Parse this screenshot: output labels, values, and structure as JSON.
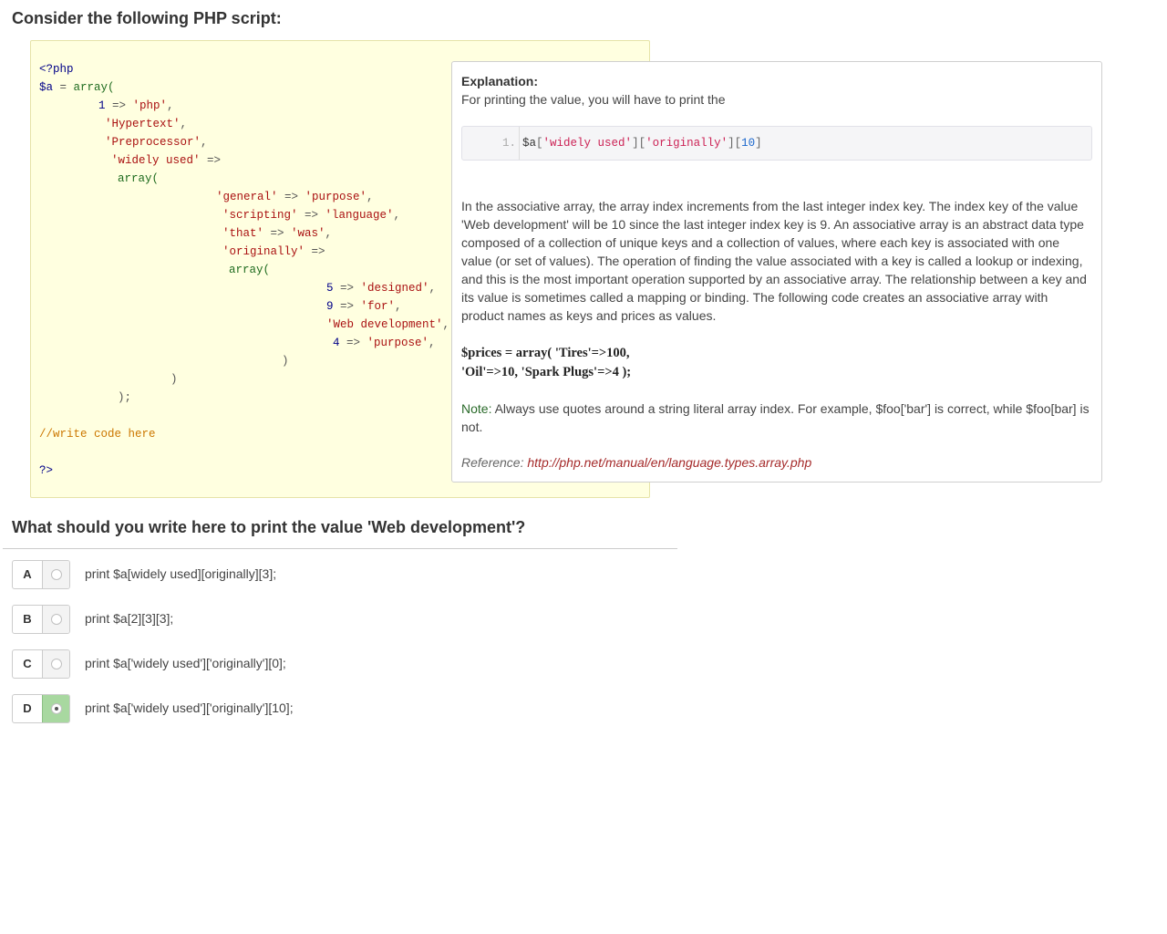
{
  "heading": "Consider the following PHP script:",
  "code": {
    "open_tag": "<?php",
    "var_a": "$a",
    "eq": " = ",
    "array_fn": "array(",
    "k1": "1",
    "arrow": " => ",
    "s_php": "'php'",
    "s_hypertext": "'Hypertext'",
    "s_preprocessor": "'Preprocessor'",
    "s_widely_used": "'widely used'",
    "s_general": "'general'",
    "s_purpose": "'purpose'",
    "s_scripting": "'scripting'",
    "s_language": "'language'",
    "s_that": "'that'",
    "s_was": "'was'",
    "s_originally": "'originally'",
    "k5": "5",
    "s_designed": "'designed'",
    "k9": "9",
    "s_for": "'for'",
    "s_webdev": "'Web development'",
    "k4": "4",
    "s_purpose2": "'purpose'",
    "close_paren": ")",
    "close_stmt": ");",
    "comment": "//write code here",
    "close_tag": "?>"
  },
  "explanation": {
    "title": "Explanation:",
    "intro": "For printing the value, you will have to print the",
    "snippet_line_no": "1.",
    "snippet_var": "$a",
    "snippet_b1": "[",
    "snippet_k1": "'widely used'",
    "snippet_b2": "][",
    "snippet_k2": "'originally'",
    "snippet_b3": "][",
    "snippet_k3": "10",
    "snippet_b4": "]",
    "paragraph": "In the associative array, the array index increments from the last integer index key. The index key of the value 'Web development' will be 10 since the last integer index key is 9. An associative array is an abstract data type composed of a collection of unique keys and a collection of values, where each key is associated with one value (or set of values). The operation of finding the value associated with a key is called a lookup or indexing, and this is the most important operation supported by an associative array. The relationship between a key and its value is sometimes called a mapping or binding. The following code creates an associative array with product names as keys and prices as values.",
    "example_line1": "$prices = array( 'Tires'=>100,",
    "example_line2": "'Oil'=>10, 'Spark Plugs'=>4 );",
    "note_label": "Note:",
    "note_text": " Always use quotes around a string literal array index. For example, $foo['bar'] is correct, while $foo[bar] is not.",
    "reference_label": "Reference: ",
    "reference_link": "http://php.net/manual/en/language.types.array.php"
  },
  "question": "What should you write here to print the value 'Web development'?",
  "options": [
    {
      "letter": "A",
      "text": "print $a[widely used][originally][3];",
      "selected": false
    },
    {
      "letter": "B",
      "text": "print $a[2][3][3];",
      "selected": false
    },
    {
      "letter": "C",
      "text": "print $a['widely used']['originally'][0];",
      "selected": false
    },
    {
      "letter": "D",
      "text": "print $a['widely used']['originally'][10];",
      "selected": true
    }
  ],
  "colors": {
    "code_bg": "#ffffe0",
    "correct_option": "#a8d8a0",
    "string": "#aa1111",
    "keyword": "#000088",
    "comment": "#cc7700",
    "link": "#a52a2a"
  }
}
